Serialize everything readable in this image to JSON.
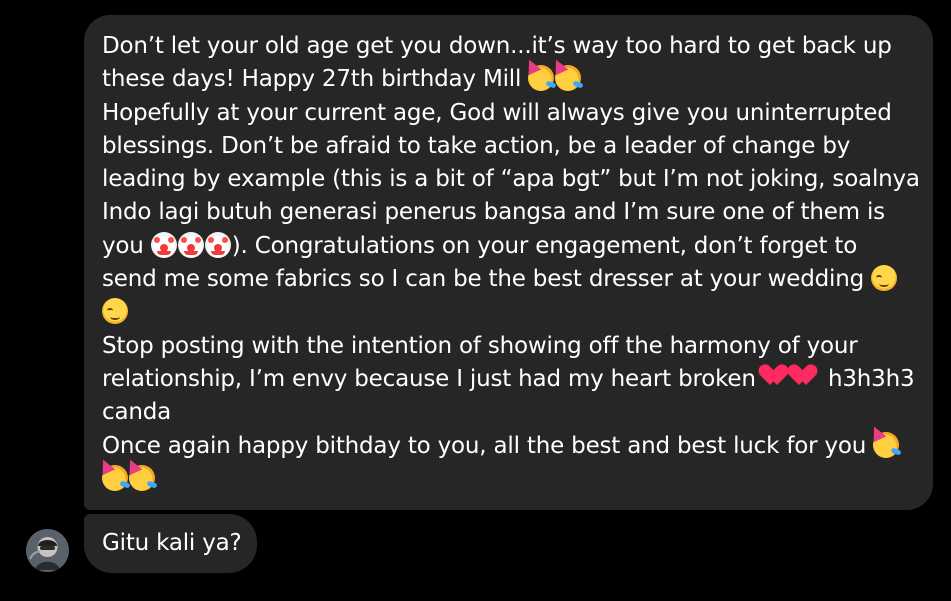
{
  "messages": [
    {
      "lines": [
        [
          {
            "text": "Don’t let your old age get you down...it’s way too hard to get back up"
          }
        ],
        [
          {
            "text": "these days! Happy 27th birthday Mill "
          },
          {
            "emoji": "partying-face"
          },
          {
            "emoji": "partying-face"
          }
        ],
        [
          {
            "text": "Hopefully at your current age, God will always give you uninterrupted"
          }
        ],
        [
          {
            "text": "blessings. Don’t be afraid to take action, be a leader of change by"
          }
        ],
        [
          {
            "text": "leading by example (this is a bit of “apa bgt” but I’m not joking, soalnya"
          }
        ],
        [
          {
            "text": "Indo lagi butuh generasi penerus bangsa and I’m sure one of them is"
          }
        ],
        [
          {
            "text": "you "
          },
          {
            "emoji": "clown-face"
          },
          {
            "emoji": "clown-face"
          },
          {
            "emoji": "clown-face"
          },
          {
            "text": "). Congratulations on your engagement, don’t forget to"
          }
        ],
        [
          {
            "text": "send me some fabrics so I can be the best dresser at your wedding "
          },
          {
            "emoji": "relieved-face"
          }
        ],
        [
          {
            "emoji": "relieved-face"
          }
        ],
        [
          {
            "text": "Stop posting with the intention of showing off the harmony of your"
          }
        ],
        [
          {
            "text": "relationship, I’m envy because I just had my heart broken "
          },
          {
            "emoji": "broken-heart"
          },
          {
            "emoji": "broken-heart"
          },
          {
            "text": " h3h3h3"
          }
        ],
        [
          {
            "text": "canda"
          }
        ],
        [
          {
            "text": "Once again happy bithday to you, all the best and best luck for you "
          },
          {
            "emoji": "partying-face"
          }
        ],
        [
          {
            "emoji": "partying-face"
          },
          {
            "emoji": "partying-face"
          }
        ]
      ]
    },
    {
      "text": "Gitu kali ya?",
      "sender_avatar": "profile-photo"
    }
  ],
  "colors": {
    "background": "#000000",
    "bubble": "#262626",
    "text": "#ffffff"
  }
}
